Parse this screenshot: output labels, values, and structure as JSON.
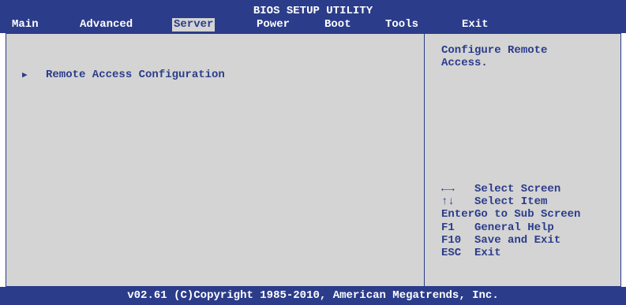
{
  "title": "BIOS SETUP UTILITY",
  "tabs": [
    {
      "label": "Main"
    },
    {
      "label": "Advanced"
    },
    {
      "label": "Server"
    },
    {
      "label": "Power"
    },
    {
      "label": "Boot"
    },
    {
      "label": "Tools"
    },
    {
      "label": "Exit"
    }
  ],
  "active_tab": "Server",
  "main": {
    "items": [
      {
        "label": "Remote Access Configuration",
        "marker": "▶"
      }
    ]
  },
  "help": {
    "text": "Configure Remote\nAccess."
  },
  "keys": [
    {
      "key": "←→",
      "desc": "  Select Screen"
    },
    {
      "key": "↑↓",
      "desc": "Select Item"
    },
    {
      "key": "Enter",
      "desc": "Go to Sub Screen"
    },
    {
      "key": "F1",
      "desc": "General Help"
    },
    {
      "key": "F10",
      "desc": "Save and Exit"
    },
    {
      "key": "ESC",
      "desc": "Exit"
    }
  ],
  "footer": "v02.61 (C)Copyright 1985-2010, American Megatrends, Inc.",
  "colors": {
    "header_blue": "#2b3c8a",
    "panel_gray": "#d4d4d4",
    "text_white": "#ffffff"
  }
}
